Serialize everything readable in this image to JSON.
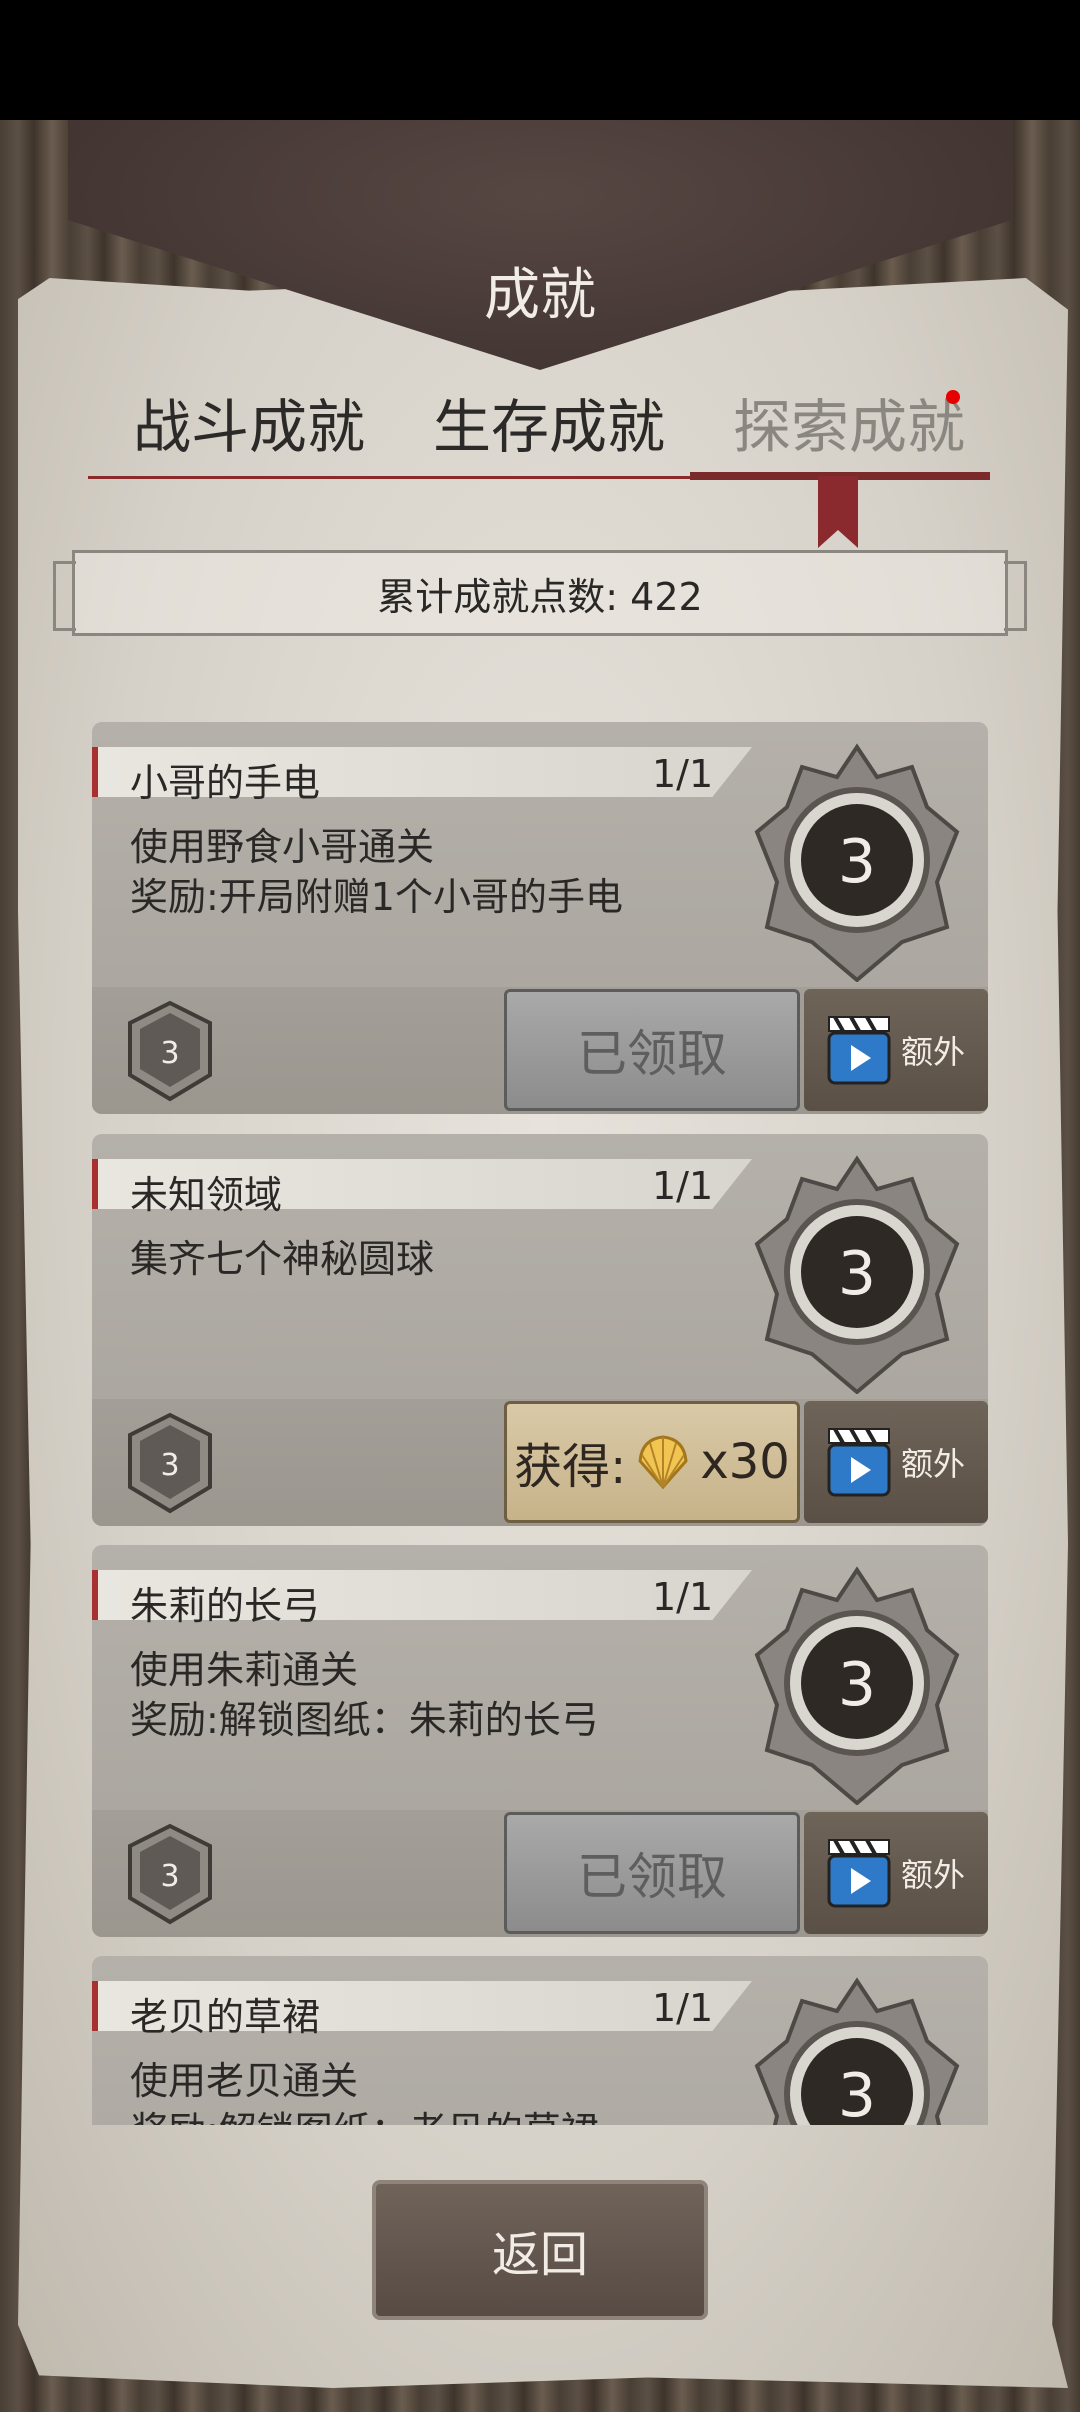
{
  "title": "成就",
  "tabs": [
    "战斗成就",
    "生存成就",
    "探索成就"
  ],
  "points_label": "累计成就点数: 422",
  "achievements": [
    {
      "name": "小哥的手电",
      "progress": "1/1",
      "desc1": "使用野食小哥通关",
      "desc2": "奖励:开局附赠1个小哥的手电",
      "medal_value": "3",
      "small_medal_value": "3",
      "action": "已领取",
      "extra": "额外"
    },
    {
      "name": "未知领域",
      "progress": "1/1",
      "desc1": "集齐七个神秘圆球",
      "desc2": "",
      "medal_value": "3",
      "small_medal_value": "3",
      "action": "获得:",
      "reward_amount": "x30",
      "extra": "额外"
    },
    {
      "name": "朱莉的长弓",
      "progress": "1/1",
      "desc1": "使用朱莉通关",
      "desc2": "奖励:解锁图纸：朱莉的长弓",
      "medal_value": "3",
      "small_medal_value": "3",
      "action": "已领取",
      "extra": "额外"
    },
    {
      "name": "老贝的草裙",
      "progress": "1/1",
      "desc1": "使用老贝通关",
      "desc2": "奖励:解锁图纸：老贝的草裙",
      "medal_value": "3"
    }
  ],
  "back_label": "返回",
  "icons": [
    "medal-icon",
    "video-icon",
    "shell-icon"
  ],
  "colors": {
    "accent_red": "#8a2a2e",
    "notify_dot": "#e60000"
  }
}
